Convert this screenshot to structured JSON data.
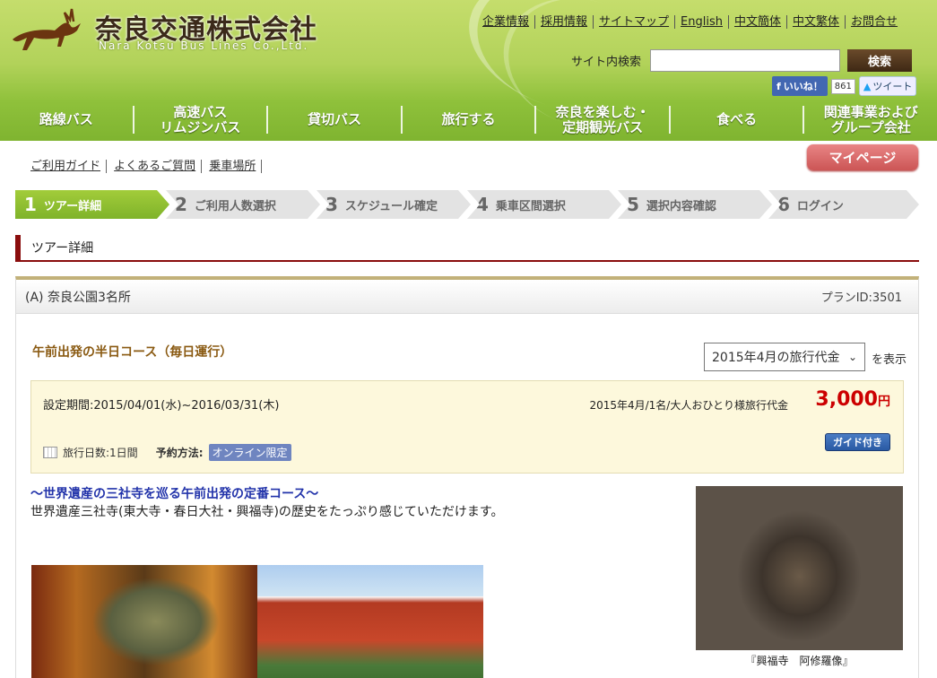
{
  "header": {
    "logo_jp": "奈良交通株式会社",
    "logo_en": "Nara Kotsu Bus Lines Co.,Ltd.",
    "utility_links": [
      "企業情報",
      "採用情報",
      "サイトマップ",
      "English",
      "中文簡体",
      "中文繁体",
      "お問合せ"
    ],
    "search": {
      "label": "サイト内検索",
      "placeholder": "",
      "value": "",
      "button": "検索"
    },
    "social": {
      "facebook_label": "いいね！",
      "facebook_count": "861",
      "twitter_label": "ツイート"
    },
    "nav": [
      "路線バス",
      "高速バス\nリムジンバス",
      "貸切バス",
      "旅行する",
      "奈良を楽しむ・\n定期観光バス",
      "食べる",
      "関連事業および\nグループ会社"
    ]
  },
  "subnav": {
    "links": [
      "ご利用ガイド",
      "よくあるご質問",
      "乗車場所"
    ],
    "mypage": "マイページ"
  },
  "steps": [
    {
      "num": "1",
      "label": "ツアー詳細",
      "active": true
    },
    {
      "num": "2",
      "label": "ご利用人数選択",
      "active": false
    },
    {
      "num": "3",
      "label": "スケジュール確定",
      "active": false
    },
    {
      "num": "4",
      "label": "乗車区間選択",
      "active": false
    },
    {
      "num": "5",
      "label": "選択内容確認",
      "active": false
    },
    {
      "num": "6",
      "label": "ログイン",
      "active": false
    }
  ],
  "section_title": "ツアー詳細",
  "plan": {
    "name": "(A) 奈良公園3名所",
    "plan_id": "プランID:3501",
    "course_name": "午前出発の半日コース（毎日運行）",
    "month_select": {
      "value": "2015年4月の旅行代金",
      "suffix": "を表示"
    },
    "period": "設定期間:2015/04/01(水)~2016/03/31(木)",
    "price_label": "2015年4月/1名/大人おひとり様旅行代金",
    "price": "3,000",
    "price_unit": "円",
    "days": "旅行日数:1日間",
    "booking_label": "予約方法:",
    "booking_tag": "オンライン限定",
    "guide_tag": "ガイド付き",
    "catch": "～世界遺産の三社寺を巡る午前出発の定番コース～",
    "description": "世界遺産三社寺(東大寺・春日大社・興福寺)の歴史をたっぷり感じていただけます。",
    "image_caption": "『興福寺　阿修羅像』"
  },
  "colors": {
    "header_green": "#8fc13b",
    "active_step": "#a2cc3a",
    "price_red": "#cc0000",
    "accent_brown": "#8a0d0d"
  }
}
